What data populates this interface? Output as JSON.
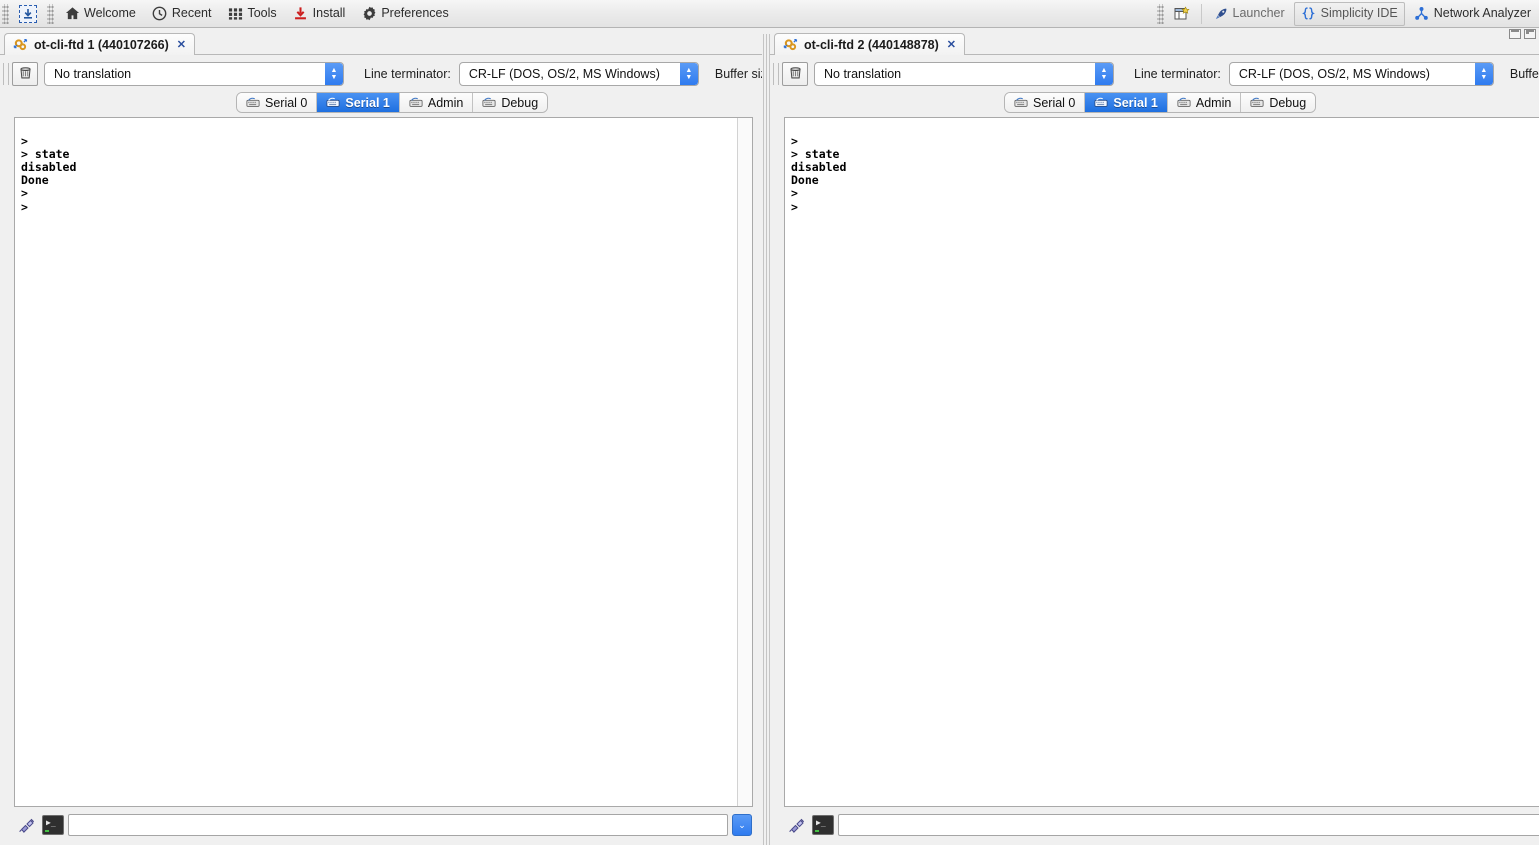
{
  "toolbar": {
    "chip_icon": "chip-download-icon",
    "items": [
      {
        "icon": "home-icon",
        "label": "Welcome"
      },
      {
        "icon": "clock-icon",
        "label": "Recent"
      },
      {
        "icon": "grid-icon",
        "label": "Tools"
      },
      {
        "icon": "download-icon",
        "label": "Install"
      },
      {
        "icon": "gear-icon",
        "label": "Preferences"
      }
    ],
    "right_items": [
      {
        "icon": "new-perspective-icon",
        "label": "",
        "selected": false
      },
      {
        "icon": "rocket-icon",
        "label": "Launcher",
        "selected": false
      },
      {
        "icon": "braces-icon",
        "label": "Simplicity IDE",
        "selected": true
      },
      {
        "icon": "network-icon",
        "label": "Network Analyzer",
        "selected": false
      }
    ]
  },
  "colors": {
    "accent_blue": "#2f7bef",
    "selected_tab_blue": "#1e6fe0",
    "toolbar_bg": "#ebebeb",
    "panel_bg": "#f0f0f0",
    "terminal_bg": "#ffffff",
    "terminal_fg": "#000000",
    "link_blue": "#2b4f9e"
  },
  "window_controls": {
    "restore_label": "restore-icon",
    "maximize_label": "maximize-icon"
  },
  "panels": [
    {
      "editor_tab": {
        "icon": "serial-console-icon",
        "title": "ot-cli-ftd 1 (440107266)",
        "close_glyph": "✕"
      },
      "options": {
        "clear_icon": "trash-clear-icon",
        "translation_value": "No translation",
        "line_terminator_label": "Line terminator:",
        "line_terminator_value": "CR-LF  (DOS, OS/2, MS Windows)",
        "buffer_size_label": "Buffer size"
      },
      "serial_tabs": [
        {
          "label": "Serial 0",
          "icon": "keyboard-icon",
          "active": false
        },
        {
          "label": "Serial 1",
          "icon": "keyboard-icon",
          "active": true
        },
        {
          "label": "Admin",
          "icon": "keyboard-icon",
          "active": false
        },
        {
          "label": "Debug",
          "icon": "keyboard-icon",
          "active": false
        }
      ],
      "terminal_text": ">\n> state\ndisabled\nDone\n>\n>",
      "input": {
        "plug_icon": "plug-connection-icon",
        "console_icon": "terminal-prompt-icon",
        "value": "",
        "placeholder": "",
        "dropdown_glyph": "⌄"
      }
    },
    {
      "editor_tab": {
        "icon": "serial-console-icon",
        "title": "ot-cli-ftd 2 (440148878)",
        "close_glyph": "✕"
      },
      "options": {
        "clear_icon": "trash-clear-icon",
        "translation_value": "No translation",
        "line_terminator_label": "Line terminator:",
        "line_terminator_value": "CR-LF  (DOS, OS/2, MS Windows)",
        "buffer_size_label": "Buffer size"
      },
      "serial_tabs": [
        {
          "label": "Serial 0",
          "icon": "keyboard-icon",
          "active": false
        },
        {
          "label": "Serial 1",
          "icon": "keyboard-icon",
          "active": true
        },
        {
          "label": "Admin",
          "icon": "keyboard-icon",
          "active": false
        },
        {
          "label": "Debug",
          "icon": "keyboard-icon",
          "active": false
        }
      ],
      "terminal_text": ">\n> state\ndisabled\nDone\n>\n>",
      "input": {
        "plug_icon": "plug-connection-icon",
        "console_icon": "terminal-prompt-icon",
        "value": "",
        "placeholder": "",
        "dropdown_glyph": "⌄"
      }
    }
  ]
}
